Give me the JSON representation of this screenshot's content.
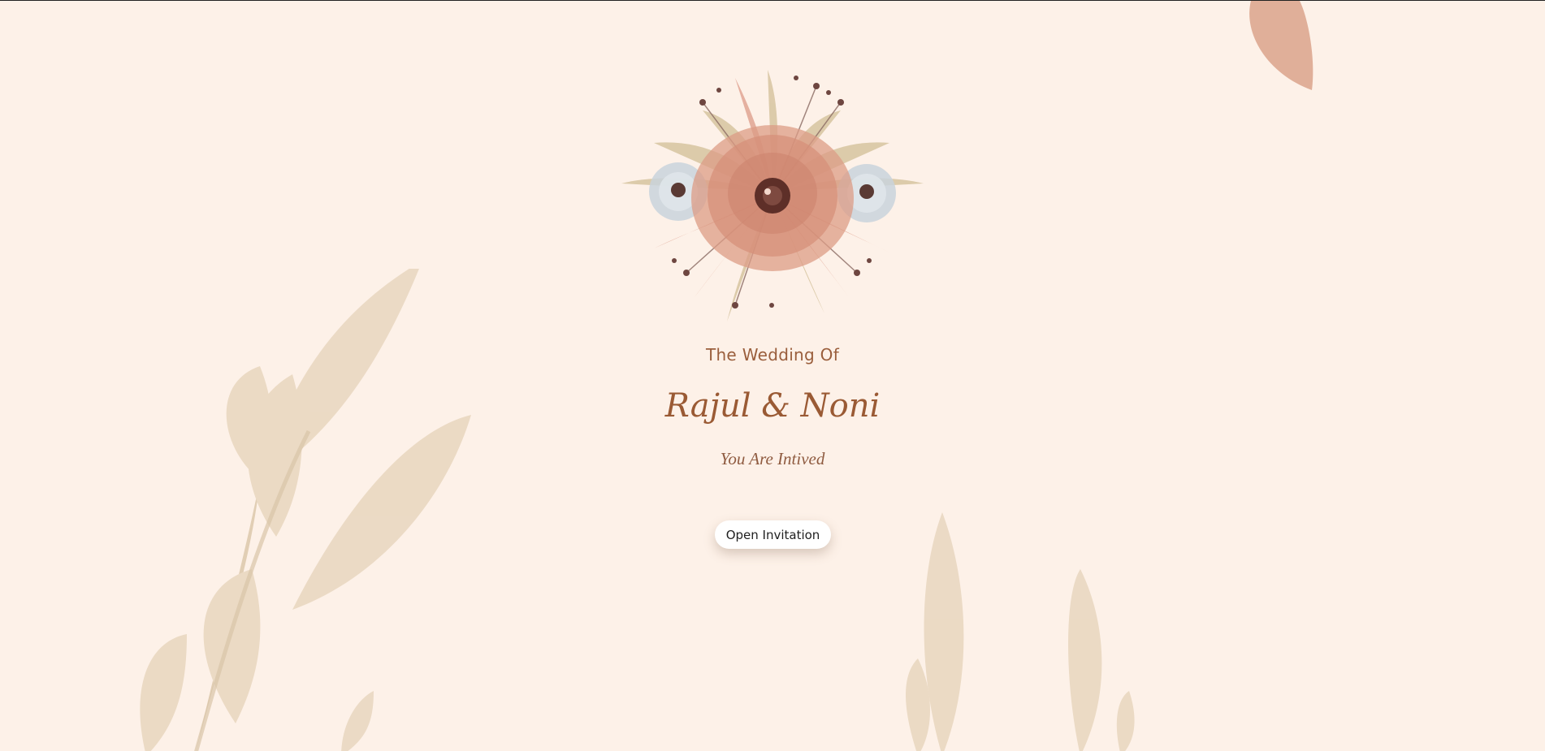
{
  "invitation": {
    "subtitle": "The Wedding Of",
    "couple_names": "Rajul & Noni",
    "invited_text": "You Are Intived",
    "open_button_label": "Open Invitation"
  },
  "decor": {
    "bouquet": "floral-bouquet-illustration",
    "background_leaves": "watercolor-leaves",
    "petal": "falling-petal"
  },
  "colors": {
    "background": "#fdf1e8",
    "accent_text": "#9a5a34",
    "petal_pink": "#d99a84",
    "leaf_beige": "#e6d3bb",
    "button_bg": "#ffffff"
  }
}
